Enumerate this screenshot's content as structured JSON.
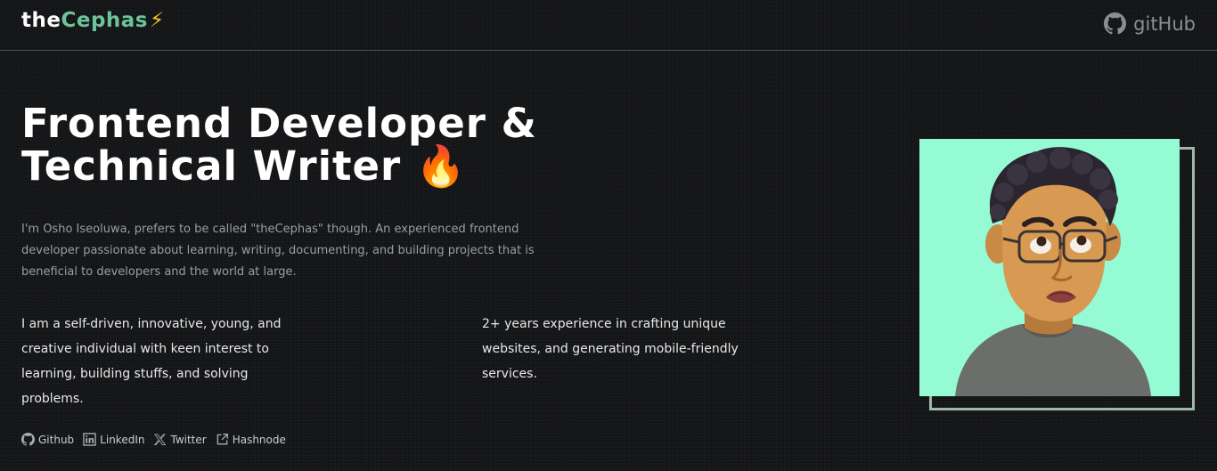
{
  "header": {
    "logo_part1": "the",
    "logo_part2": "Cephas",
    "logo_bolt": "⚡",
    "github_label": "gitHub",
    "github_icon": "github-icon"
  },
  "hero": {
    "title": "Frontend Developer & Technical Writer 🔥",
    "intro": "I'm Osho Iseoluwa, prefers to be called \"theCephas\" though. An experienced frontend developer passionate about learning, writing, documenting, and building projects that is beneficial to developers and the world at large.",
    "col1": "I am a self-driven, innovative, young, and creative individual with keen interest to learning, building stuffs, and solving problems.",
    "col2": "2+ years experience in crafting unique websites, and generating mobile-friendly services."
  },
  "socials": [
    {
      "label": "Github",
      "icon": "github-icon"
    },
    {
      "label": "LinkedIn",
      "icon": "linkedin-icon"
    },
    {
      "label": "Twitter",
      "icon": "x-icon"
    },
    {
      "label": "Hashnode",
      "icon": "external-link-icon"
    }
  ],
  "colors": {
    "background": "#141517",
    "accent": "#6cc49a",
    "avatar_bg": "#94fbd5",
    "frame": "#9fb6ad"
  }
}
